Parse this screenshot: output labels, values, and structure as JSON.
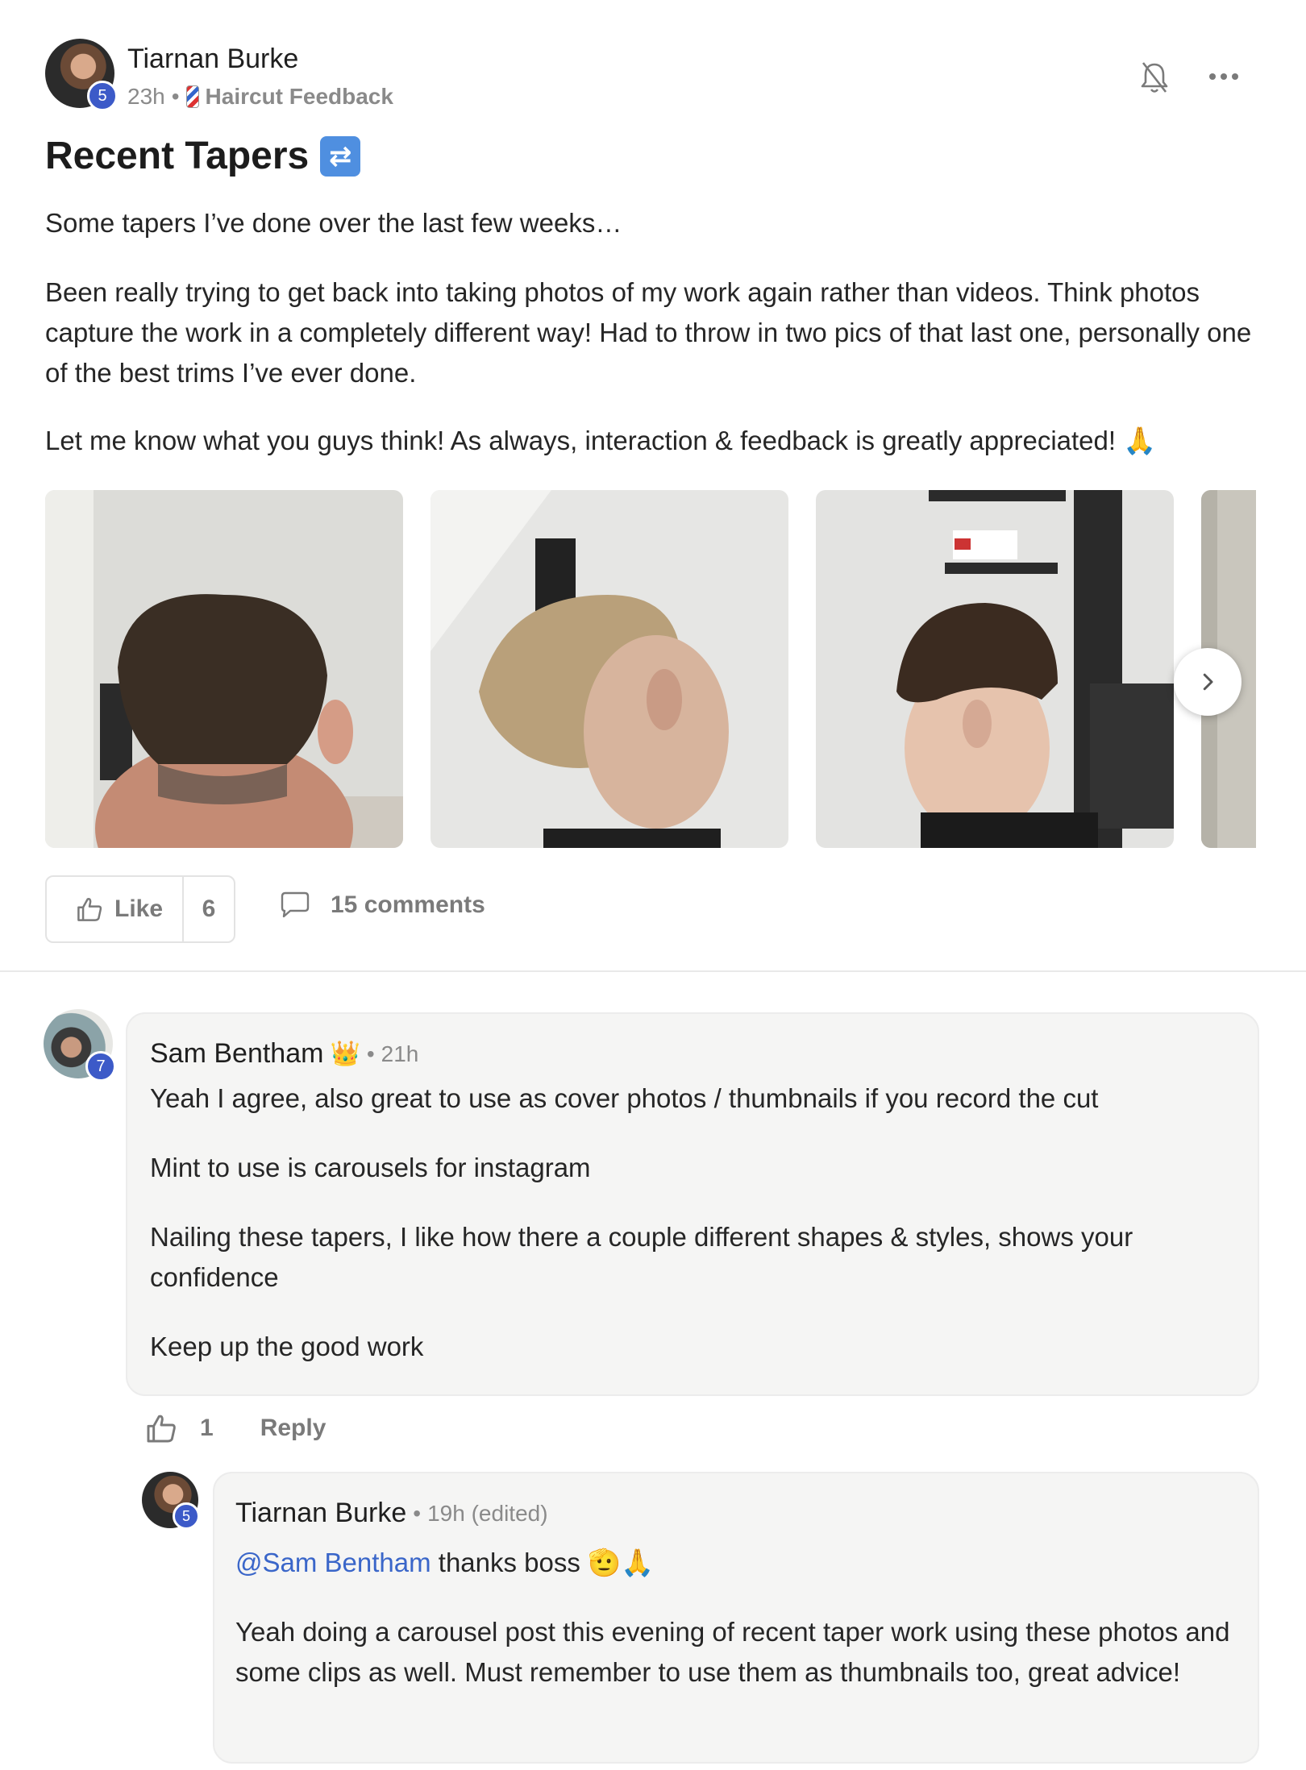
{
  "post": {
    "author": {
      "name": "Tiarnan Burke",
      "level": "5"
    },
    "time": "23h",
    "separator": "•",
    "category": {
      "label": "Haircut Feedback",
      "icon": "barber-pole-icon"
    },
    "title": "Recent Tapers",
    "title_emoji": "🔁",
    "paragraphs": [
      "Some tapers I’ve done over the last few weeks…",
      "Been really trying to get back into taking photos of my work again rather than videos. Think photos capture the work in a completely different way! Had to throw in two pics of that last one, personally one of the best trims I’ve ever done.",
      "Let me know what you guys think! As always, interaction & feedback is greatly appreciated! 🙏"
    ],
    "actions": {
      "like_label": "Like",
      "like_count": "6",
      "comments_label": "15 comments"
    }
  },
  "comments": [
    {
      "author": "Sam Bentham",
      "badge": "👑",
      "level": "7",
      "time": "21h",
      "paragraphs": [
        "Yeah I agree, also great to use as cover photos / thumbnails if you record the cut",
        "Mint to use is carousels for instagram",
        "Nailing these tapers, I like how there a couple different shapes & styles, shows your confidence",
        "Keep up the good work"
      ],
      "like_count": "1",
      "reply_label": "Reply"
    }
  ],
  "reply": {
    "author": "Tiarnan Burke",
    "level": "5",
    "time": "19h (edited)",
    "mention": "@Sam Bentham",
    "first_line_rest": " thanks boss 🫡🙏",
    "paragraph": "Yeah doing a carousel post this evening of recent taper work using these photos and some clips as well. Must remember to use them as thumbnails too, great advice!"
  },
  "colors": {
    "level_badge": "#3c5ac8",
    "mention": "#3a66c9",
    "muted_text": "#7a7a7a"
  }
}
